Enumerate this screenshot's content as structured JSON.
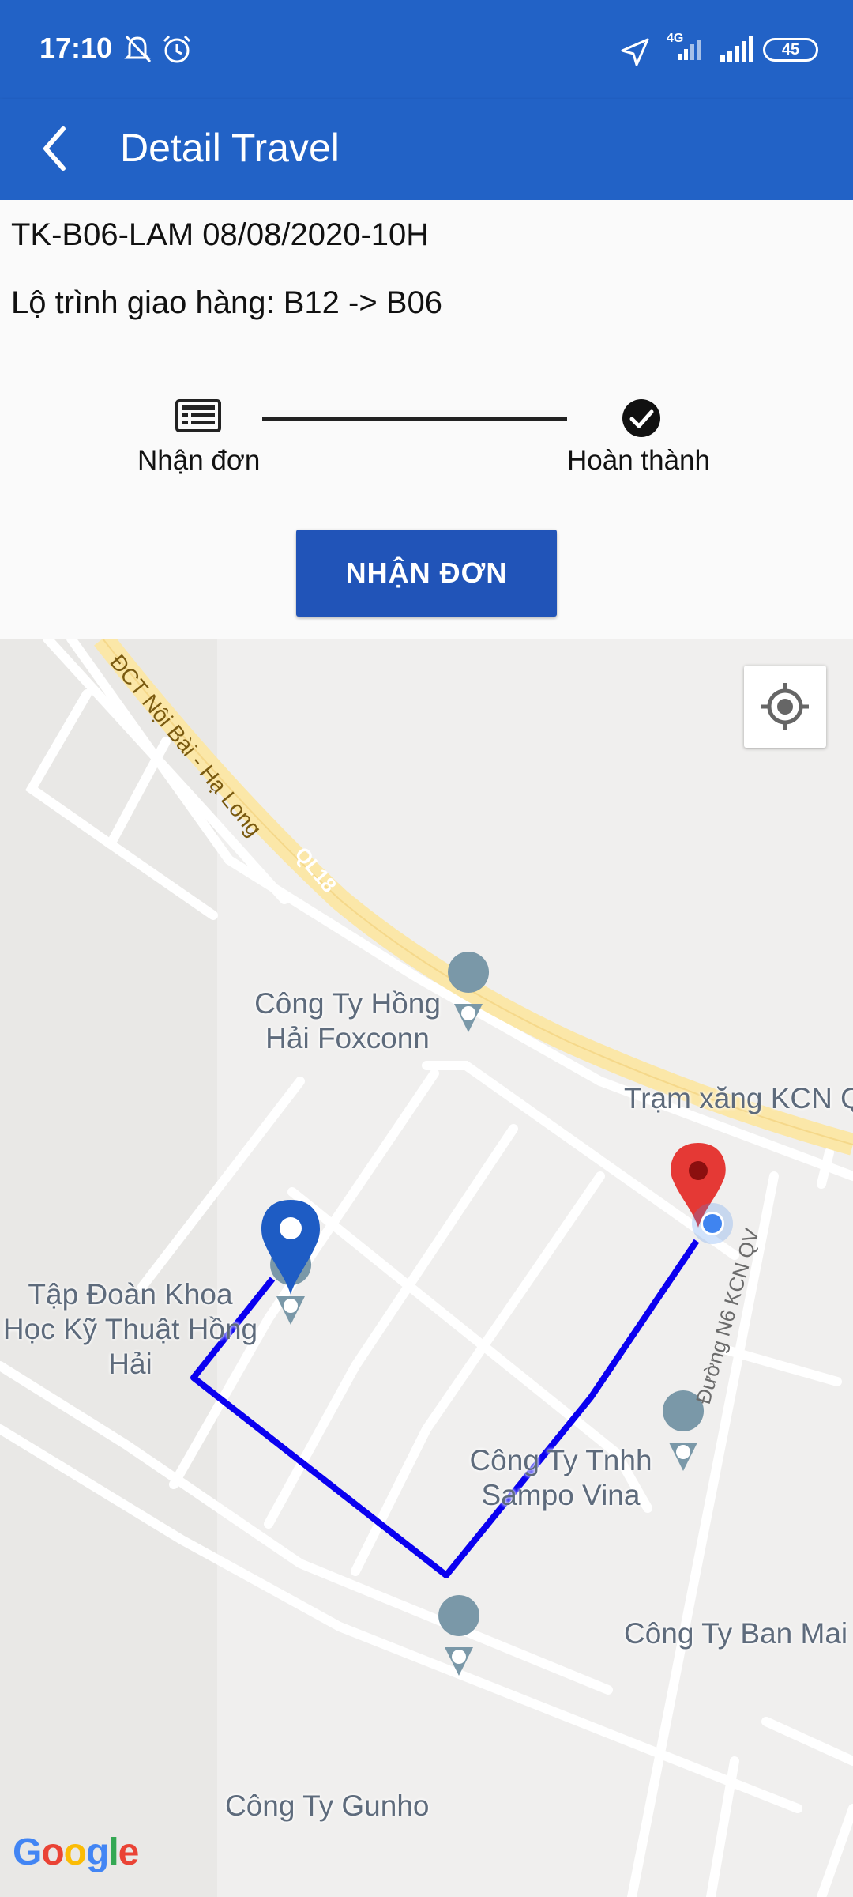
{
  "status_bar": {
    "time": "17:10",
    "network": "4G",
    "battery": "45",
    "icons": [
      "bell-off-icon",
      "alarm-icon",
      "location-arrow-icon",
      "signal-icon",
      "battery-icon"
    ]
  },
  "app_bar": {
    "title": "Detail Travel",
    "back_icon": "back-arrow-icon"
  },
  "order": {
    "code": "TK-B06-LAM 08/08/2020-10H",
    "route": "Lộ trình giao hàng: B12 -> B06"
  },
  "steps": [
    {
      "label": "Nhận đơn",
      "icon": "list-icon"
    },
    {
      "label": "Hoàn thành",
      "icon": "check-circle-icon"
    }
  ],
  "action_button": {
    "label": "NHẬN ĐƠN"
  },
  "map": {
    "road_labels": [
      "ĐCT Nội Bài - Hạ Long",
      "QL18",
      "Đường N6 KCN QV"
    ],
    "places": [
      "Công Ty Hồng Hải Foxconn",
      "Trạm xăng KCN Q",
      "Tập Đoàn Khoa Học Kỹ Thuật Hồng Hải",
      "Công Ty Tnhh Sampo Vina",
      "Công Ty Ban Mai",
      "Công Ty Gunho"
    ],
    "route_color": "#0a00f0",
    "start_marker_color": "#1e5cc4",
    "end_marker_color": "#e53935",
    "attribution": "Google"
  },
  "colors": {
    "primary": "#2262c6",
    "button": "#2154b8"
  }
}
